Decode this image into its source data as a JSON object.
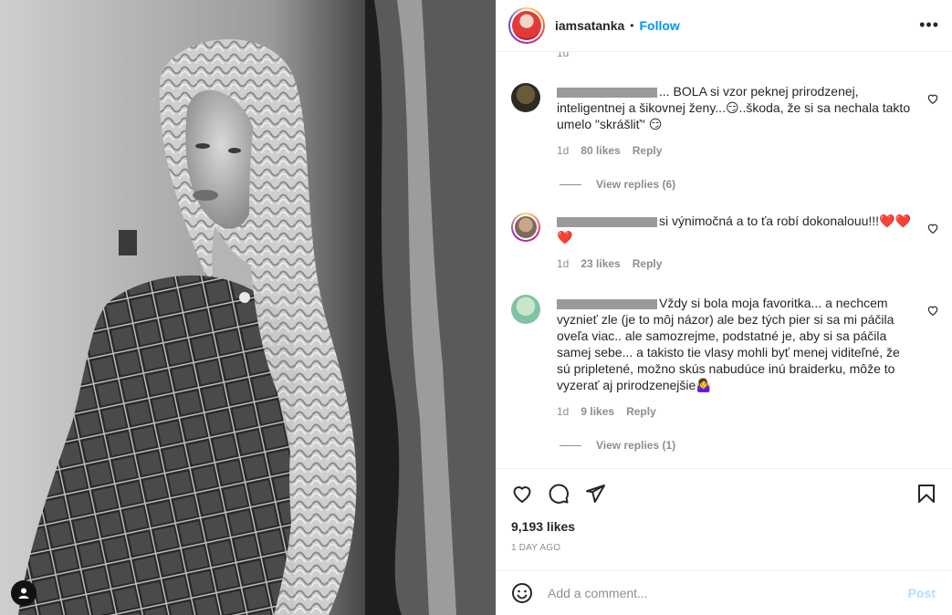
{
  "header": {
    "username": "iamsatanka",
    "separator": "•",
    "follow_label": "Follow",
    "more_label": "•••"
  },
  "comments_top_cut_time": "1d",
  "comments": [
    {
      "text": "... BOLA si vzor peknej prirodzenej, inteligentnej a šikovnej ženy...😏..škoda, že si sa nechala takto umelo \"skrášliť\" 😏",
      "time": "1d",
      "likes": "80 likes",
      "reply_label": "Reply",
      "view_replies": "View replies (6)"
    },
    {
      "text": "si výnimočná a to ťa robí dokonalouu!!!❤️❤️❤️",
      "time": "1d",
      "likes": "23 likes",
      "reply_label": "Reply"
    },
    {
      "text": "Vždy si bola moja favoritka... a nechcem vyznieť zle (je to môj názor) ale bez tých pier si sa mi páčila oveľa viac.. ale samozrejme, podstatné je, aby si sa páčila samej sebe... a takisto tie vlasy mohli byť menej viditeľné, že sú pripletené, možno skús nabudúce inú braiderku, môže to vyzerať aj prirodzenejšie🤷‍♀️",
      "time": "1d",
      "likes": "9 likes",
      "reply_label": "Reply",
      "view_replies": "View replies (1)"
    }
  ],
  "post": {
    "likes": "9,193 likes",
    "date": "1 DAY AGO"
  },
  "composer": {
    "placeholder": "Add a comment...",
    "post_label": "Post"
  },
  "icons": {
    "like": "heart-icon",
    "comment": "comment-icon",
    "share": "share-icon",
    "save": "bookmark-icon",
    "emoji": "emoji-icon",
    "more": "more-options-icon",
    "user_tag": "user-tag-icon"
  },
  "colors": {
    "accent": "#0095f6",
    "post_disabled": "#b2dffc",
    "muted": "#8e8e8e",
    "text": "#262626"
  }
}
